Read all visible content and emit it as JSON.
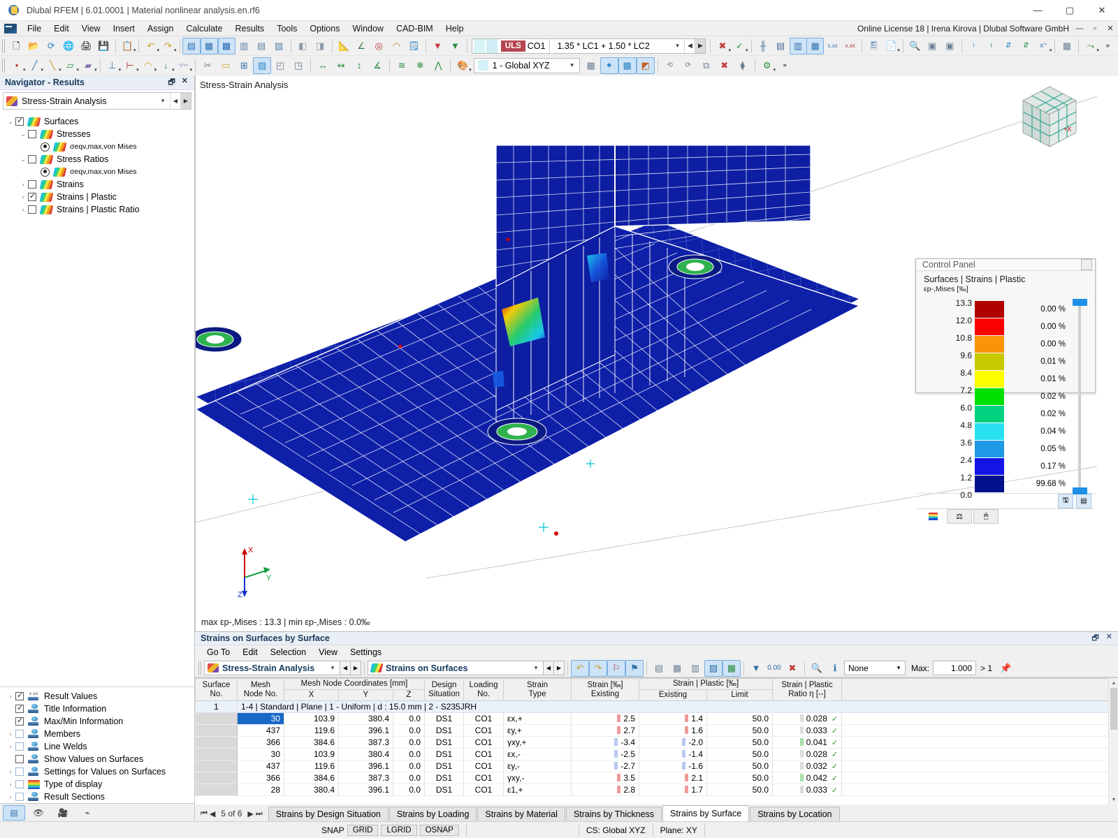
{
  "window": {
    "title": "Dlubal RFEM | 6.01.0001 | Material nonlinear analysis.en.rf6",
    "license": "Online License 18 | Irena Kirova | Dlubal Software GmbH",
    "minimize": "—",
    "maximize": "▢",
    "close": "✕"
  },
  "menu": {
    "items": [
      "File",
      "Edit",
      "View",
      "Insert",
      "Assign",
      "Calculate",
      "Results",
      "Tools",
      "Options",
      "Window",
      "CAD-BIM",
      "Help"
    ]
  },
  "toolbar": {
    "load_combination": {
      "category": "ULS",
      "code": "CO1",
      "expression": "1.35 * LC1 + 1.50 * LC2"
    },
    "coordinate_system": "1 - Global XYZ"
  },
  "navigator": {
    "title": "Navigator - Results",
    "selected_analysis": "Stress-Strain Analysis",
    "tree": [
      {
        "label": "Surfaces",
        "indent": 0,
        "twisty": "v",
        "check": "on",
        "icon": "surface-icon"
      },
      {
        "label": "Stresses",
        "indent": 1,
        "twisty": "v",
        "check": "off",
        "icon": "surface-icon"
      },
      {
        "label": "σeqv,max,von Mises",
        "indent": 2,
        "twisty": "",
        "check": "radio",
        "icon": "surface-icon"
      },
      {
        "label": "Stress Ratios",
        "indent": 1,
        "twisty": "v",
        "check": "off",
        "icon": "surface-icon"
      },
      {
        "label": "σeqv,max,von Mises",
        "indent": 2,
        "twisty": "",
        "check": "radio",
        "icon": "surface-icon"
      },
      {
        "label": "Strains",
        "indent": 1,
        "twisty": ">",
        "check": "off",
        "icon": "surface-icon"
      },
      {
        "label": "Strains | Plastic",
        "indent": 1,
        "twisty": ">",
        "check": "on",
        "icon": "surface-icon"
      },
      {
        "label": "Strains | Plastic Ratio",
        "indent": 1,
        "twisty": ">",
        "check": "off",
        "icon": "surface-icon"
      }
    ],
    "tree_bottom": [
      {
        "label": "Result Values",
        "twisty": ">",
        "check": "on",
        "icon": "result-values-icon"
      },
      {
        "label": "Title Information",
        "twisty": "",
        "check": "on",
        "icon": "label-icon"
      },
      {
        "label": "Max/Min Information",
        "twisty": "",
        "check": "on",
        "icon": "label-icon"
      },
      {
        "label": "Members",
        "twisty": ">",
        "check": "gray",
        "icon": "label-icon"
      },
      {
        "label": "Line Welds",
        "twisty": ">",
        "check": "gray",
        "icon": "label-icon"
      },
      {
        "label": "Show Values on Surfaces",
        "twisty": "",
        "check": "off",
        "icon": "label-icon"
      },
      {
        "label": "Settings for Values on Surfaces",
        "twisty": ">",
        "check": "gray",
        "icon": "label-icon"
      },
      {
        "label": "Type of display",
        "twisty": ">",
        "check": "gray",
        "icon": "rainbow-icon"
      },
      {
        "label": "Result Sections",
        "twisty": ">",
        "check": "gray",
        "icon": "label-icon"
      }
    ]
  },
  "viewport": {
    "title": "Stress-Strain Analysis",
    "max_min_info": "max εp-,Mises : 13.3 | min εp-,Mises : 0.0‰",
    "axis_labels": {
      "x": "X",
      "y": "Y",
      "z": "Z"
    },
    "cube_face": "+X"
  },
  "control_panel": {
    "title": "Control Panel",
    "subtitle": "Surfaces | Strains | Plastic",
    "unit": "εp-,Mises [‰]",
    "scale_values": [
      "13.3",
      "12.0",
      "10.8",
      "9.6",
      "8.4",
      "7.2",
      "6.0",
      "4.8",
      "3.6",
      "2.4",
      "1.2",
      "0.0"
    ],
    "colors": [
      "#b00000",
      "#fa0000",
      "#f89406",
      "#c8c800",
      "#ffff00",
      "#00e000",
      "#00d27f",
      "#28e0f0",
      "#1e9ae6",
      "#1414e6",
      "#000f8c"
    ],
    "percents": [
      "0.00 %",
      "0.00 %",
      "0.00 %",
      "0.01 %",
      "0.01 %",
      "0.02 %",
      "0.02 %",
      "0.04 %",
      "0.05 %",
      "0.17 %",
      "99.68 %"
    ]
  },
  "table_panel": {
    "title": "Strains on Surfaces by Surface",
    "menu": [
      "Go To",
      "Edit",
      "Selection",
      "View",
      "Settings"
    ],
    "analysis_combo": "Stress-Strain Analysis",
    "result_combo": "Strains on Surfaces",
    "filter_value": "None",
    "max_label": "Max:",
    "max_value": "1.000",
    "gt_label": "> 1",
    "columns": [
      {
        "top": "Surface",
        "bottom": "No."
      },
      {
        "top": "Mesh",
        "bottom": "Node No."
      },
      {
        "top": "Mesh Node Coordinates [mm]",
        "bottom": "X"
      },
      {
        "top": "",
        "bottom": "Y"
      },
      {
        "top": "",
        "bottom": "Z"
      },
      {
        "top": "Design",
        "bottom": "Situation"
      },
      {
        "top": "Loading",
        "bottom": "No."
      },
      {
        "top": "Strain",
        "bottom": "Type"
      },
      {
        "top": "Strain [‰]",
        "bottom": "Existing"
      },
      {
        "top": "Strain | Plastic [‰]",
        "bottom": "Existing"
      },
      {
        "top": "",
        "bottom": "Limit"
      },
      {
        "top": "Strain | Plastic",
        "bottom": "Ratio η [--]"
      }
    ],
    "group_row": {
      "no": "1",
      "text": "1-4 | Standard | Plane | 1 - Uniform | d : 15.0 mm | 2 - S235JRH"
    },
    "rows": [
      {
        "node": "30",
        "x": "103.9",
        "y": "380.4",
        "z": "0.0",
        "ds": "DS1",
        "lo": "CO1",
        "type": "εx,+",
        "existing": "2.5",
        "existing_sign": "r",
        "plastic": "1.4",
        "plastic_sign": "r",
        "limit": "50.0",
        "ratio": "0.028",
        "ok": "✓",
        "selected": true
      },
      {
        "node": "437",
        "x": "119.6",
        "y": "396.1",
        "z": "0.0",
        "ds": "DS1",
        "lo": "CO1",
        "type": "εy,+",
        "existing": "2.7",
        "existing_sign": "r",
        "plastic": "1.6",
        "plastic_sign": "r",
        "limit": "50.0",
        "ratio": "0.033",
        "ok": "✓",
        "selected": false
      },
      {
        "node": "366",
        "x": "384.6",
        "y": "387.3",
        "z": "0.0",
        "ds": "DS1",
        "lo": "CO1",
        "type": "γxy,+",
        "existing": "-3.4",
        "existing_sign": "b",
        "plastic": "-2.0",
        "plastic_sign": "b",
        "limit": "50.0",
        "ratio": "0.041",
        "ok": "✓",
        "selected": false
      },
      {
        "node": "30",
        "x": "103.9",
        "y": "380.4",
        "z": "0.0",
        "ds": "DS1",
        "lo": "CO1",
        "type": "εx,-",
        "existing": "-2.5",
        "existing_sign": "b",
        "plastic": "-1.4",
        "plastic_sign": "b",
        "limit": "50.0",
        "ratio": "0.028",
        "ok": "✓",
        "selected": false
      },
      {
        "node": "437",
        "x": "119.6",
        "y": "396.1",
        "z": "0.0",
        "ds": "DS1",
        "lo": "CO1",
        "type": "εy,-",
        "existing": "-2.7",
        "existing_sign": "b",
        "plastic": "-1.6",
        "plastic_sign": "b",
        "limit": "50.0",
        "ratio": "0.032",
        "ok": "✓",
        "selected": false
      },
      {
        "node": "366",
        "x": "384.6",
        "y": "387.3",
        "z": "0.0",
        "ds": "DS1",
        "lo": "CO1",
        "type": "γxy,-",
        "existing": "3.5",
        "existing_sign": "r",
        "plastic": "2.1",
        "plastic_sign": "r",
        "limit": "50.0",
        "ratio": "0.042",
        "ok": "✓",
        "selected": false
      },
      {
        "node": "28",
        "x": "380.4",
        "y": "396.1",
        "z": "0.0",
        "ds": "DS1",
        "lo": "CO1",
        "type": "ε1,+",
        "existing": "2.8",
        "existing_sign": "r",
        "plastic": "1.7",
        "plastic_sign": "r",
        "limit": "50.0",
        "ratio": "0.033",
        "ok": "✓",
        "selected": false
      }
    ],
    "pager": "5 of 6",
    "tabs": [
      {
        "label": "Strains by Design Situation",
        "active": false
      },
      {
        "label": "Strains by Loading",
        "active": false
      },
      {
        "label": "Strains by Material",
        "active": false
      },
      {
        "label": "Strains by Thickness",
        "active": false
      },
      {
        "label": "Strains by Surface",
        "active": true
      },
      {
        "label": "Strains by Location",
        "active": false
      }
    ]
  },
  "status_bar": {
    "snap": "SNAP",
    "buttons": [
      "GRID",
      "LGRID",
      "OSNAP"
    ],
    "cs": "CS: Global XYZ",
    "plane": "Plane: XY"
  }
}
